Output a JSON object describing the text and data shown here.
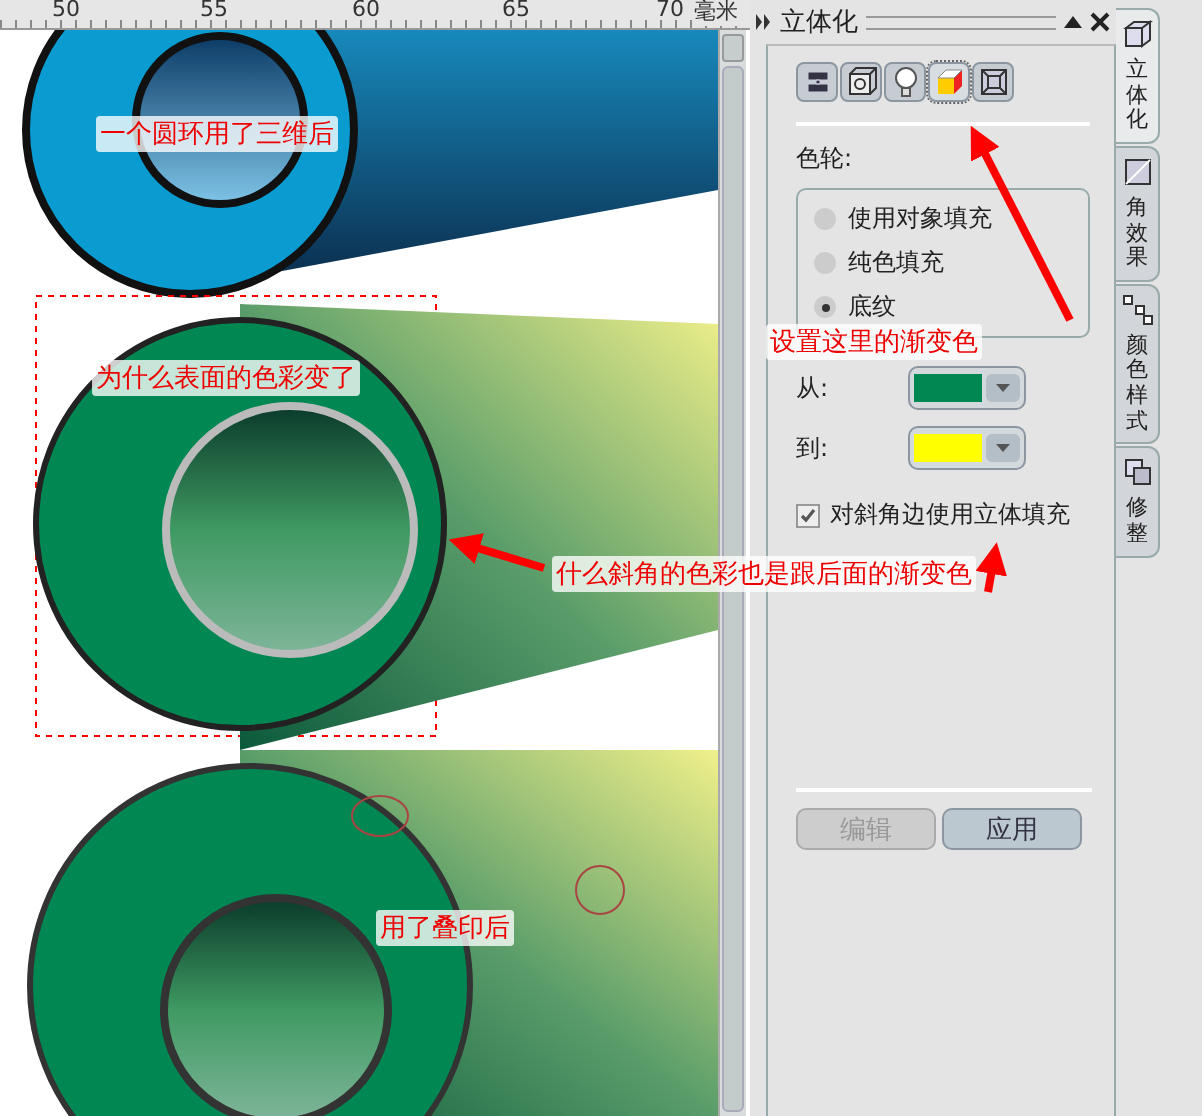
{
  "ruler": {
    "ticks": [
      "50",
      "55",
      "60",
      "65",
      "70"
    ],
    "unit": "毫米"
  },
  "annotations": [
    {
      "kind": "note",
      "text": "一个圆环用了三维后"
    },
    {
      "kind": "note",
      "text": "为什么表面的色彩变了"
    },
    {
      "kind": "note",
      "text": "设置这里的渐变色"
    },
    {
      "kind": "note",
      "text": "什么斜角的色彩也是跟后面的渐变色"
    },
    {
      "kind": "note",
      "text": "用了叠印后"
    }
  ],
  "docker": {
    "title": "立体化",
    "tools": [
      {
        "selected": false
      },
      {
        "selected": false
      },
      {
        "selected": false
      },
      {
        "selected": true
      },
      {
        "selected": false
      }
    ],
    "color_wheel_label": "色轮:",
    "fill_options": [
      {
        "label": "使用对象填充",
        "selected": false
      },
      {
        "label": "纯色填充",
        "selected": false
      },
      {
        "label": "底纹",
        "selected": true
      }
    ],
    "swatches": [
      {
        "label": "从:",
        "color": "#008752"
      },
      {
        "label": "到:",
        "color": "#ffff00"
      }
    ],
    "bevel_fill": {
      "label": "对斜角边使用立体填充",
      "checked": true
    },
    "buttons": [
      {
        "label": "编辑",
        "disabled": true
      },
      {
        "label": "应用",
        "disabled": false
      }
    ]
  },
  "side_tabs": [
    {
      "label": "立体化",
      "selected": true
    },
    {
      "label": "角效果",
      "selected": false
    },
    {
      "label": "颜色样式",
      "selected": false
    },
    {
      "label": "修整",
      "selected": false
    }
  ]
}
